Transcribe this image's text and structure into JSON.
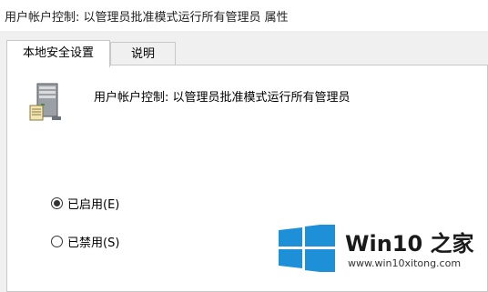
{
  "window": {
    "title": "用户帐户控制: 以管理员批准模式运行所有管理员 属性"
  },
  "tabs": [
    {
      "label": "本地安全设置",
      "active": true
    },
    {
      "label": "说明",
      "active": false
    }
  ],
  "policy": {
    "name": "用户帐户控制: 以管理员批准模式运行所有管理员",
    "icon": "server-computer-icon"
  },
  "options": [
    {
      "label": "已启用(E)",
      "selected": true
    },
    {
      "label": "已禁用(S)",
      "selected": false
    }
  ],
  "watermark": {
    "brand": "Win10 之家",
    "url": "www.win10xitong.com",
    "logo": "windows-logo-icon",
    "logo_color": "#1e90d8"
  },
  "colors": {
    "window_bg": "#f0f0f0",
    "panel_bg": "#ffffff",
    "border": "#c8c8c8"
  }
}
